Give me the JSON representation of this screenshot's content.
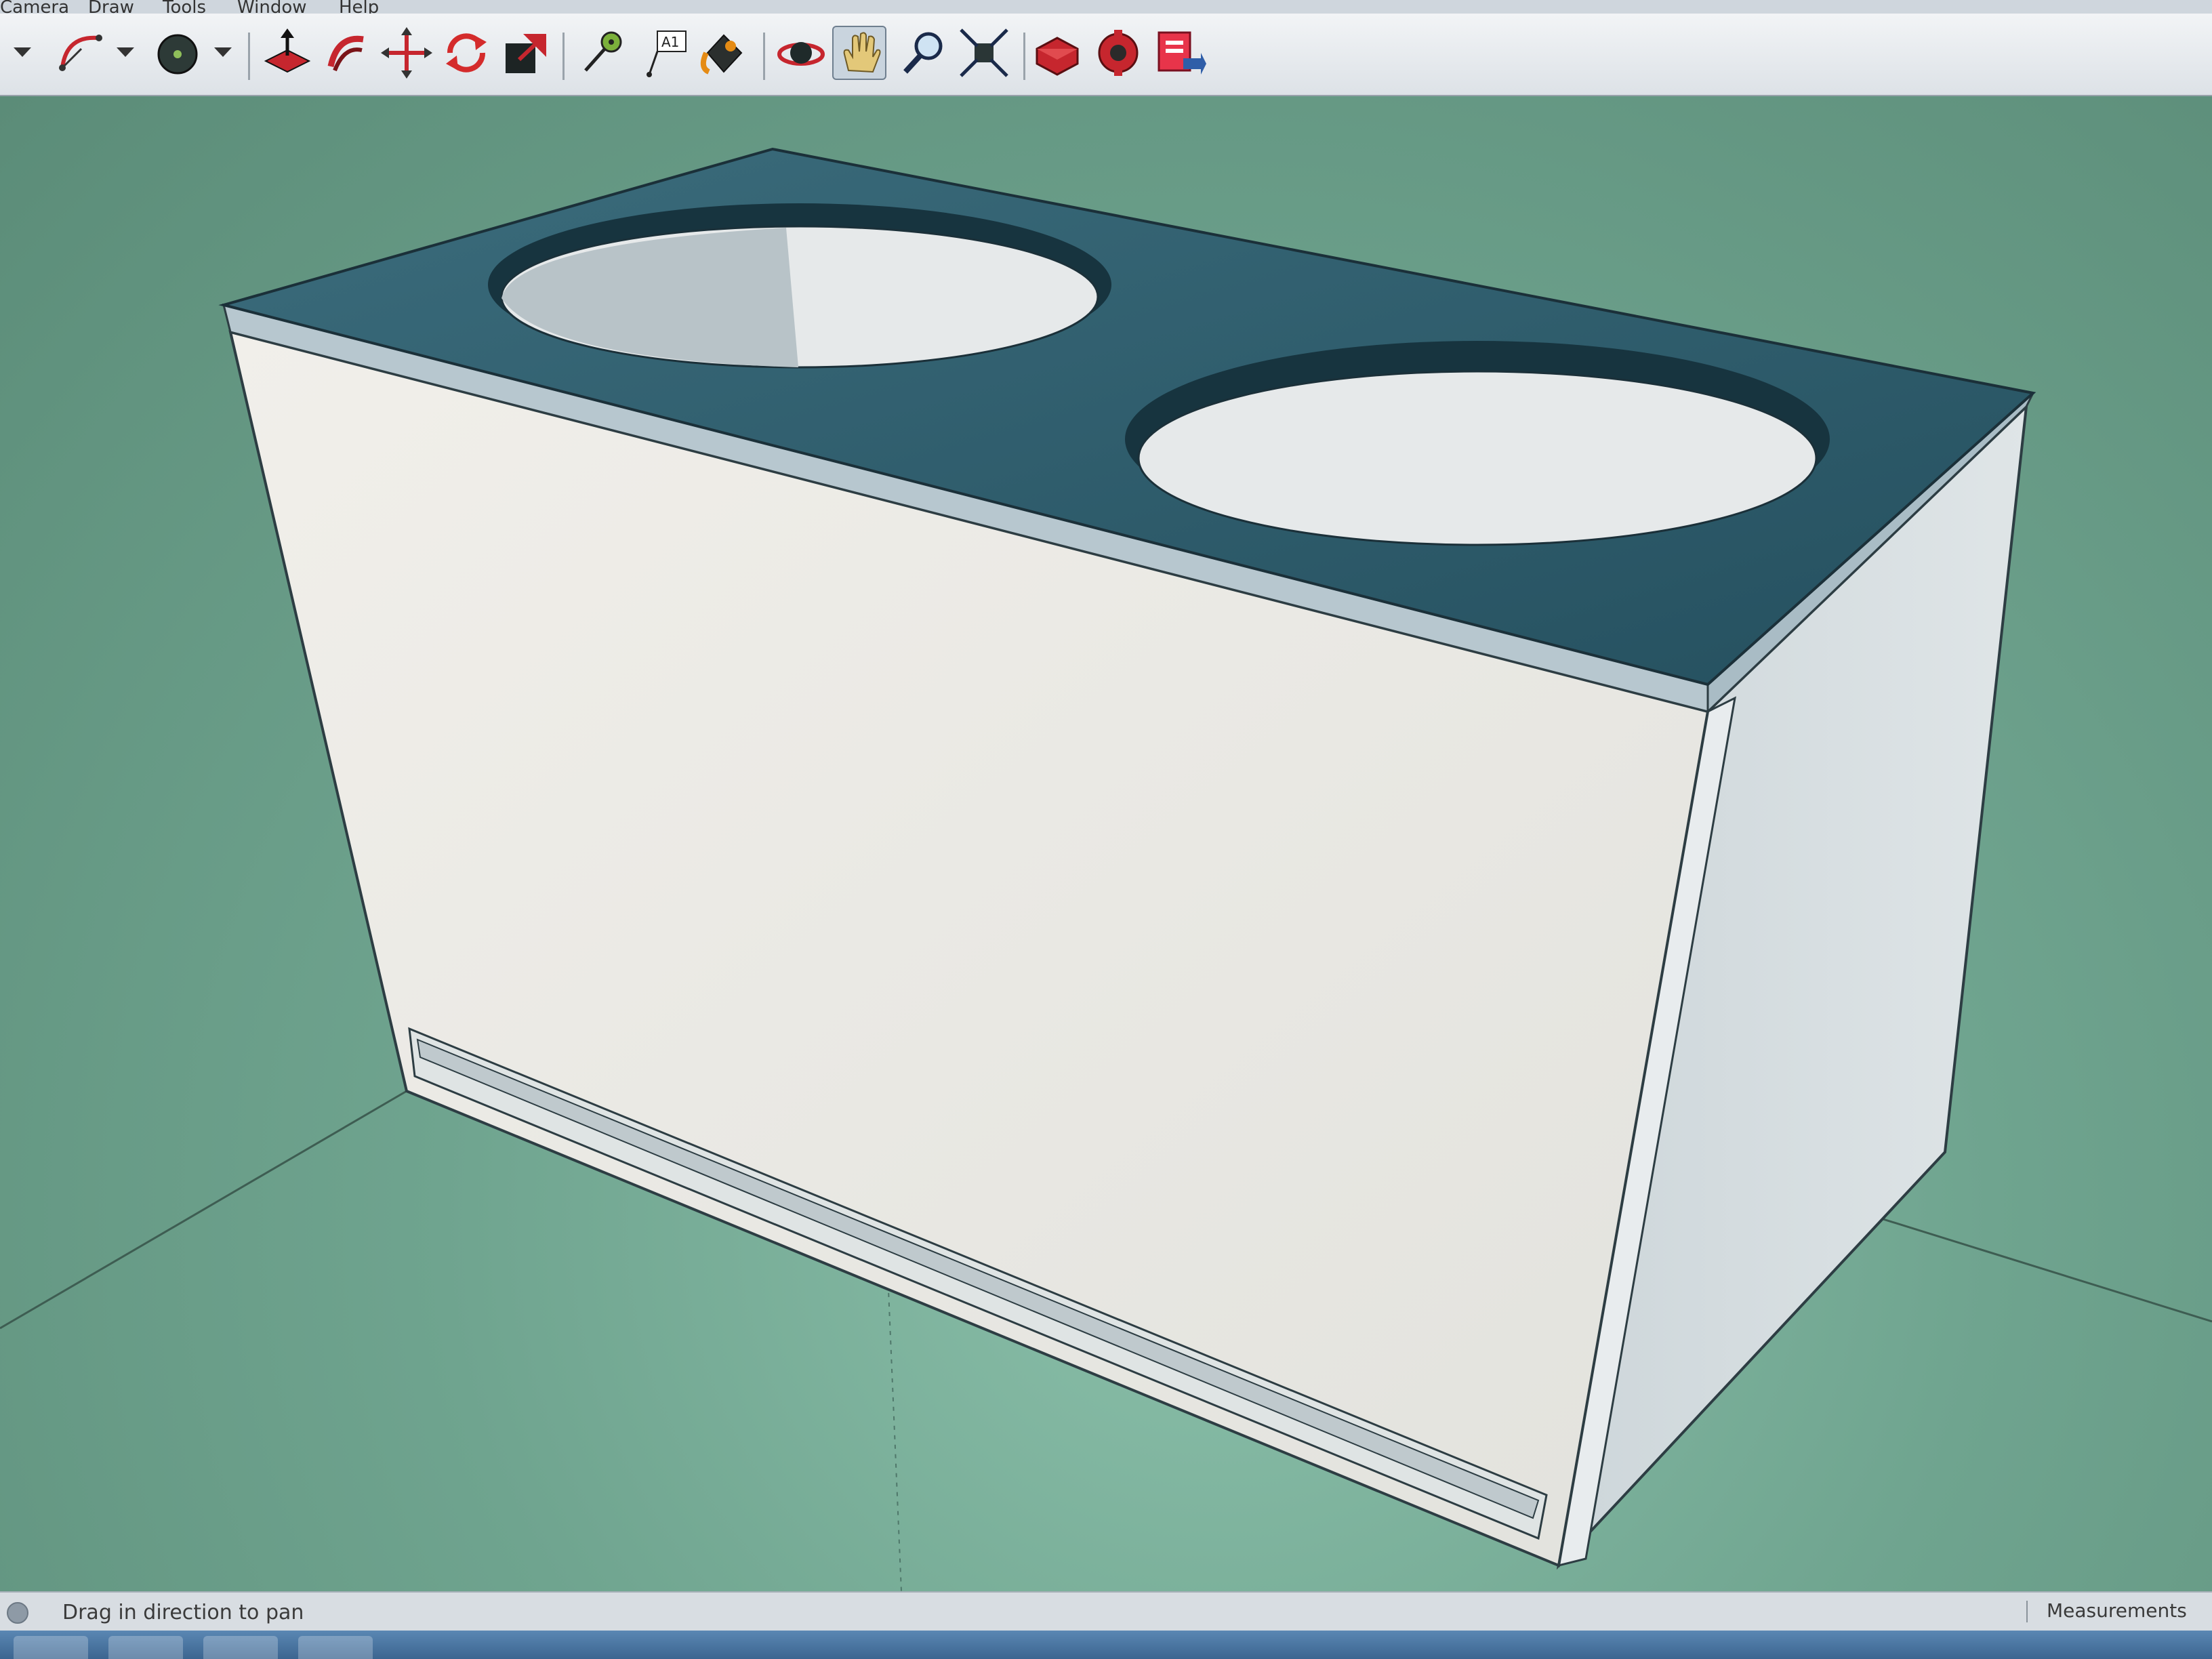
{
  "menubar": {
    "items": [
      {
        "id": "camera",
        "label": "Camera"
      },
      {
        "id": "draw",
        "label": "Draw"
      },
      {
        "id": "tools",
        "label": "Tools"
      },
      {
        "id": "window",
        "label": "Window"
      },
      {
        "id": "help",
        "label": "Help"
      }
    ]
  },
  "toolbar": {
    "tools": [
      {
        "id": "arc",
        "icon": "arc-icon",
        "has_dropdown": true
      },
      {
        "id": "shapes",
        "icon": "circle-icon",
        "has_dropdown": true
      },
      {
        "id": "push-pull",
        "icon": "push-pull-icon"
      },
      {
        "id": "follow-me",
        "icon": "follow-me-icon"
      },
      {
        "id": "move",
        "icon": "move-icon"
      },
      {
        "id": "rotate",
        "icon": "rotate-icon"
      },
      {
        "id": "scale",
        "icon": "scale-icon"
      },
      {
        "id": "tape-measure",
        "icon": "tape-measure-icon"
      },
      {
        "id": "text",
        "icon": "text-icon",
        "label": "A1"
      },
      {
        "id": "paint-bucket",
        "icon": "paint-bucket-icon"
      },
      {
        "id": "orbit",
        "icon": "orbit-icon"
      },
      {
        "id": "pan",
        "icon": "pan-hand-icon",
        "active": true
      },
      {
        "id": "zoom",
        "icon": "zoom-icon"
      },
      {
        "id": "zoom-extents",
        "icon": "zoom-extents-icon"
      },
      {
        "id": "3d-warehouse",
        "icon": "warehouse-icon"
      },
      {
        "id": "extension-warehouse",
        "icon": "extension-warehouse-icon"
      },
      {
        "id": "send-to-layout",
        "icon": "layout-icon"
      }
    ]
  },
  "status": {
    "hint": "Drag in direction to pan",
    "measurements_label": "Measurements"
  },
  "colors": {
    "ground": "#6fa48f",
    "box_front": "#ebe9e4",
    "box_side": "#d3d9dc",
    "box_top": "#2f5e6e",
    "active_tool_bg": "#c9d4de"
  },
  "model": {
    "description_hidden": true
  }
}
